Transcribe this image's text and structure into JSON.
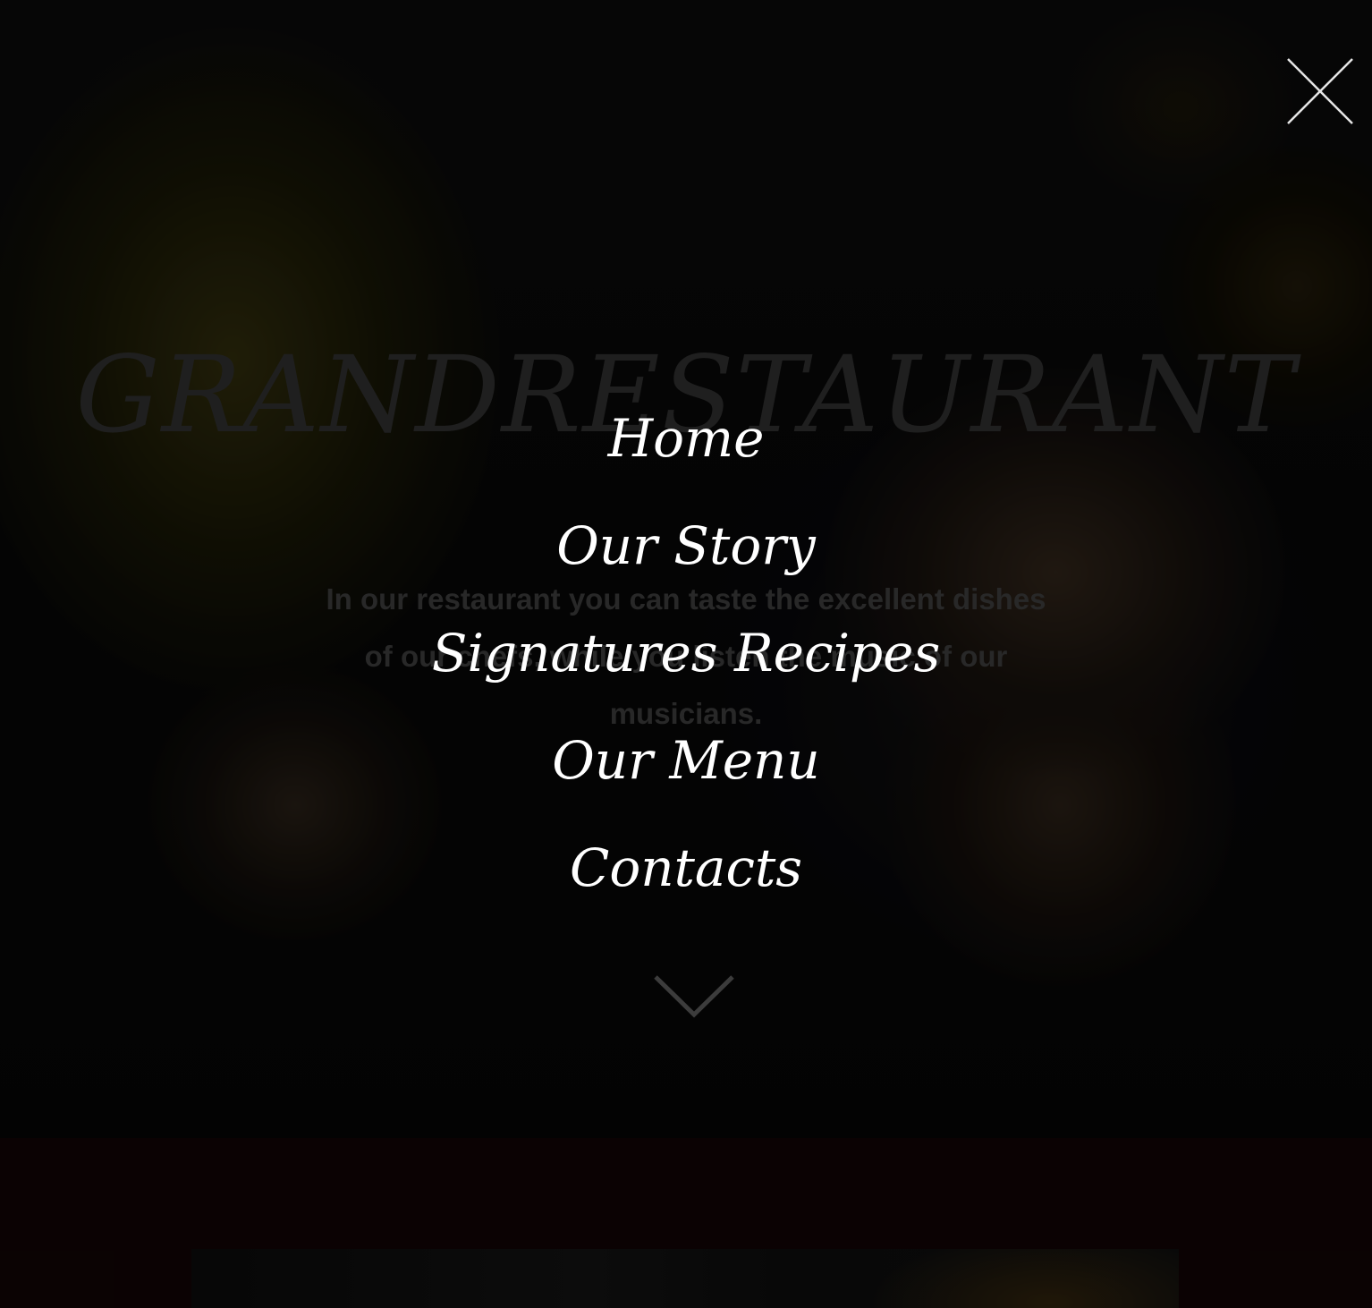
{
  "hero": {
    "brand": "GRANDRESTAURANT",
    "tagline": "In our restaurant you can taste the excellent dishes of our chefs, while you listen the music of our musicians."
  },
  "nav": {
    "items": [
      {
        "label": "Home"
      },
      {
        "label": "Our Story"
      },
      {
        "label": "Signatures Recipes"
      },
      {
        "label": "Our Menu"
      },
      {
        "label": "Contacts"
      }
    ],
    "close_icon": "close-icon",
    "scroll_icon": "chevron-down-icon"
  },
  "colors": {
    "overlay_text": "#ffffff",
    "lower_section_bg": "#140506"
  }
}
